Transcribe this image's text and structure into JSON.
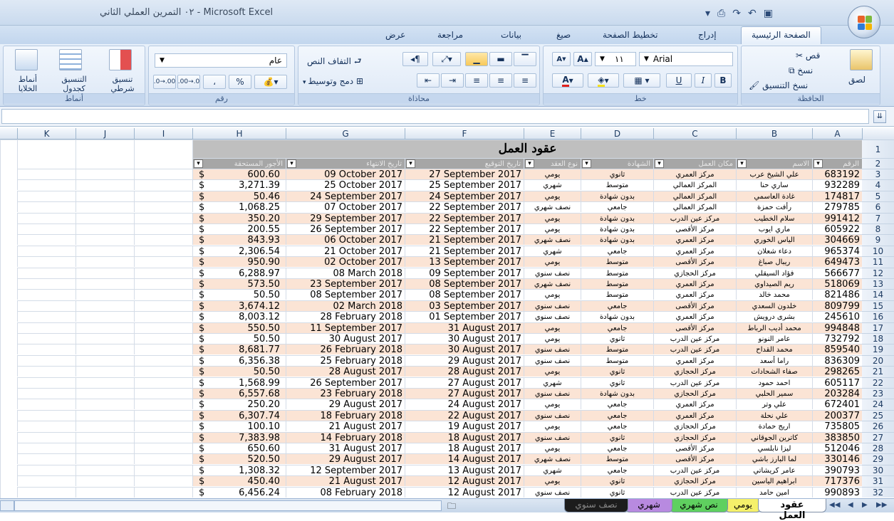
{
  "window": {
    "title": "٠٢ التمرين العملي الثاني - Microsoft Excel"
  },
  "tabs": [
    {
      "label": "الصفحة الرئيسية",
      "active": true
    },
    {
      "label": "إدراج"
    },
    {
      "label": "تخطيط الصفحة"
    },
    {
      "label": "صيغ"
    },
    {
      "label": "بيانات"
    },
    {
      "label": "مراجعة"
    },
    {
      "label": "عرض"
    }
  ],
  "ribbon": {
    "clipboard": {
      "label": "الحافظة",
      "paste": "لصق",
      "cut": "قص",
      "copy": "نسخ",
      "format_painter": "نسخ التنسيق"
    },
    "font": {
      "label": "خط",
      "font_name": "Arial",
      "font_size": "١١",
      "bold": "B",
      "italic": "I",
      "underline": "U"
    },
    "alignment": {
      "label": "محاذاة",
      "wrap_text": "التفاف النص",
      "merge_center": "دمج وتوسيط"
    },
    "number": {
      "label": "رقم",
      "format": "عام",
      "percent": "%",
      "comma": "،",
      "inc_decimal": ".00→.0",
      "dec_decimal": ".0→.00"
    },
    "styles": {
      "label": "أنماط",
      "conditional": "تنسيق شرطي",
      "as_table": "التنسيق كجدول",
      "cell_styles": "أنماط الخلايا"
    }
  },
  "columns": [
    "A",
    "B",
    "C",
    "D",
    "E",
    "F",
    "G",
    "H",
    "I",
    "J",
    "K"
  ],
  "sheet_title": "عقود العمل",
  "headers": [
    "الرقم",
    "الاسم",
    "مكان العمل",
    "الشهادة",
    "نوع العقد",
    "تاريخ التوقيع",
    "تاريخ الانتهاء",
    "الأجور المستحقة"
  ],
  "rows": [
    {
      "n": 3,
      "id": "683192",
      "name": "علي الشيخ عرب",
      "place": "مركز العمري",
      "degree": "ثانوي",
      "type": "يومي",
      "sign": "27 September 2017",
      "end": "09 October 2017",
      "pay": "600.60"
    },
    {
      "n": 4,
      "id": "932289",
      "name": "ساري حنا",
      "place": "المركز العمالي",
      "degree": "متوسط",
      "type": "شهري",
      "sign": "25 September 2017",
      "end": "25 October 2017",
      "pay": "3,271.39"
    },
    {
      "n": 5,
      "id": "174817",
      "name": "غادة العاسمي",
      "place": "المركز العمالي",
      "degree": "بدون شهادة",
      "type": "يومي",
      "sign": "24 September 2017",
      "end": "24 September 2017",
      "pay": "50.46"
    },
    {
      "n": 6,
      "id": "279785",
      "name": "رأفت حمزة",
      "place": "المركز العمالي",
      "degree": "جامعي",
      "type": "نصف شهري",
      "sign": "22 September 2017",
      "end": "07 October 2017",
      "pay": "1,068.25"
    },
    {
      "n": 7,
      "id": "991412",
      "name": "سلام الخطيب",
      "place": "مركز عين الدرب",
      "degree": "بدون شهادة",
      "type": "يومي",
      "sign": "22 September 2017",
      "end": "29 September 2017",
      "pay": "350.20"
    },
    {
      "n": 8,
      "id": "605922",
      "name": "ماري ايوب",
      "place": "مركز الأقصى",
      "degree": "بدون شهادة",
      "type": "يومي",
      "sign": "22 September 2017",
      "end": "26 September 2017",
      "pay": "200.55"
    },
    {
      "n": 9,
      "id": "304669",
      "name": "الياس الخوري",
      "place": "مركز العمري",
      "degree": "بدون شهادة",
      "type": "نصف شهري",
      "sign": "21 September 2017",
      "end": "06 October 2017",
      "pay": "843.93"
    },
    {
      "n": 10,
      "id": "965374",
      "name": "دعاء شعلان",
      "place": "مركز العمري",
      "degree": "جامعي",
      "type": "شهري",
      "sign": "21 September 2017",
      "end": "21 October 2017",
      "pay": "2,306.54"
    },
    {
      "n": 11,
      "id": "649473",
      "name": "ريبال صباغ",
      "place": "مركز الأقصى",
      "degree": "متوسط",
      "type": "يومي",
      "sign": "13 September 2017",
      "end": "02 October 2017",
      "pay": "950.90"
    },
    {
      "n": 12,
      "id": "566677",
      "name": "فؤاد السيقلي",
      "place": "مركز الحجازي",
      "degree": "متوسط",
      "type": "نصف سنوي",
      "sign": "09 September 2017",
      "end": "08 March 2018",
      "pay": "6,288.97"
    },
    {
      "n": 13,
      "id": "518069",
      "name": "ريم الصيداوي",
      "place": "مركز العمري",
      "degree": "متوسط",
      "type": "نصف شهري",
      "sign": "08 September 2017",
      "end": "23 September 2017",
      "pay": "573.50"
    },
    {
      "n": 14,
      "id": "821486",
      "name": "محمد خالد",
      "place": "مركز العمري",
      "degree": "متوسط",
      "type": "يومي",
      "sign": "08 September 2017",
      "end": "08 September 2017",
      "pay": "50.50"
    },
    {
      "n": 15,
      "id": "809799",
      "name": "خلدون السعدي",
      "place": "مركز الأقصى",
      "degree": "جامعي",
      "type": "نصف سنوي",
      "sign": "03 September 2017",
      "end": "02 March 2018",
      "pay": "3,674.12"
    },
    {
      "n": 16,
      "id": "245610",
      "name": "بشرى درويش",
      "place": "مركز العمري",
      "degree": "بدون شهادة",
      "type": "نصف سنوي",
      "sign": "01 September 2017",
      "end": "28 February 2018",
      "pay": "8,003.12"
    },
    {
      "n": 17,
      "id": "994848",
      "name": "محمد أديب الرباط",
      "place": "مركز الأقصى",
      "degree": "جامعي",
      "type": "يومي",
      "sign": "31 August 2017",
      "end": "11 September 2017",
      "pay": "550.50"
    },
    {
      "n": 18,
      "id": "732792",
      "name": "عامر النونو",
      "place": "مركز عين الدرب",
      "degree": "ثانوي",
      "type": "يومي",
      "sign": "30 August 2017",
      "end": "30 August 2017",
      "pay": "50.50"
    },
    {
      "n": 19,
      "id": "859540",
      "name": "محمد القداح",
      "place": "مركز عين الدرب",
      "degree": "متوسط",
      "type": "نصف سنوي",
      "sign": "30 August 2017",
      "end": "26 February 2018",
      "pay": "8,681.77"
    },
    {
      "n": 20,
      "id": "836309",
      "name": "راما أسعد",
      "place": "مركز العمري",
      "degree": "متوسط",
      "type": "نصف سنوي",
      "sign": "29 August 2017",
      "end": "25 February 2018",
      "pay": "6,356.38"
    },
    {
      "n": 21,
      "id": "298265",
      "name": "صفاء الشحادات",
      "place": "مركز الحجازي",
      "degree": "ثانوي",
      "type": "يومي",
      "sign": "28 August 2017",
      "end": "28 August 2017",
      "pay": "50.50"
    },
    {
      "n": 22,
      "id": "605117",
      "name": "احمد حمود",
      "place": "مركز عين الدرب",
      "degree": "ثانوي",
      "type": "شهري",
      "sign": "27 August 2017",
      "end": "26 September 2017",
      "pay": "1,568.99"
    },
    {
      "n": 23,
      "id": "203284",
      "name": "سمير الحلبي",
      "place": "مركز الحجازي",
      "degree": "بدون شهادة",
      "type": "نصف سنوي",
      "sign": "27 August 2017",
      "end": "23 February 2018",
      "pay": "6,557.68"
    },
    {
      "n": 24,
      "id": "672401",
      "name": "علي وتر",
      "place": "مركز العمري",
      "degree": "جامعي",
      "type": "يومي",
      "sign": "24 August 2017",
      "end": "29 August 2017",
      "pay": "250.20"
    },
    {
      "n": 25,
      "id": "200377",
      "name": "علي نحلة",
      "place": "مركز العمري",
      "degree": "جامعي",
      "type": "نصف سنوي",
      "sign": "22 August 2017",
      "end": "18 February 2018",
      "pay": "6,307.74"
    },
    {
      "n": 26,
      "id": "735805",
      "name": "اريج حمادة",
      "place": "مركز الحجازي",
      "degree": "جامعي",
      "type": "يومي",
      "sign": "19 August 2017",
      "end": "21 August 2017",
      "pay": "100.10"
    },
    {
      "n": 27,
      "id": "383850",
      "name": "كاترين الجوقاني",
      "place": "مركز الحجازي",
      "degree": "ثانوي",
      "type": "نصف سنوي",
      "sign": "18 August 2017",
      "end": "14 February 2018",
      "pay": "7,383.98"
    },
    {
      "n": 28,
      "id": "512046",
      "name": "ليزا نابلسي",
      "place": "مركز الأقصى",
      "degree": "جامعي",
      "type": "يومي",
      "sign": "18 August 2017",
      "end": "31 August 2017",
      "pay": "650.60"
    },
    {
      "n": 29,
      "id": "330146",
      "name": "لما البارز باشي",
      "place": "مركز الأقصى",
      "degree": "متوسط",
      "type": "نصف شهري",
      "sign": "14 August 2017",
      "end": "29 August 2017",
      "pay": "520.50"
    },
    {
      "n": 30,
      "id": "390793",
      "name": "عامر كريشاتي",
      "place": "مركز عين الدرب",
      "degree": "جامعي",
      "type": "شهري",
      "sign": "13 August 2017",
      "end": "12 September 2017",
      "pay": "1,308.32"
    },
    {
      "n": 31,
      "id": "717376",
      "name": "ابراهيم الياسين",
      "place": "مركز الحجازي",
      "degree": "ثانوي",
      "type": "يومي",
      "sign": "12 August 2017",
      "end": "21 August 2017",
      "pay": "450.40"
    },
    {
      "n": 32,
      "id": "990893",
      "name": "امين حامد",
      "place": "مركز عين الدرب",
      "degree": "ثانوي",
      "type": "نصف سنوي",
      "sign": "12 August 2017",
      "end": "08 February 2018",
      "pay": "6,456.24"
    }
  ],
  "currency": "$",
  "sheet_tabs": [
    {
      "label": "عقود العمل",
      "active": true,
      "color": "#ffffff"
    },
    {
      "label": "يومي",
      "color": "#f5f06a"
    },
    {
      "label": "نص شهري",
      "color": "#5fd05f"
    },
    {
      "label": "شهري",
      "color": "#b88ae0"
    },
    {
      "label": "نصف سنوي",
      "color": "#1c1c1c"
    }
  ],
  "colors": {
    "band": "#fbe4d5",
    "header_bg": "#bfbfbf",
    "ribbon_text": "#15325c"
  }
}
